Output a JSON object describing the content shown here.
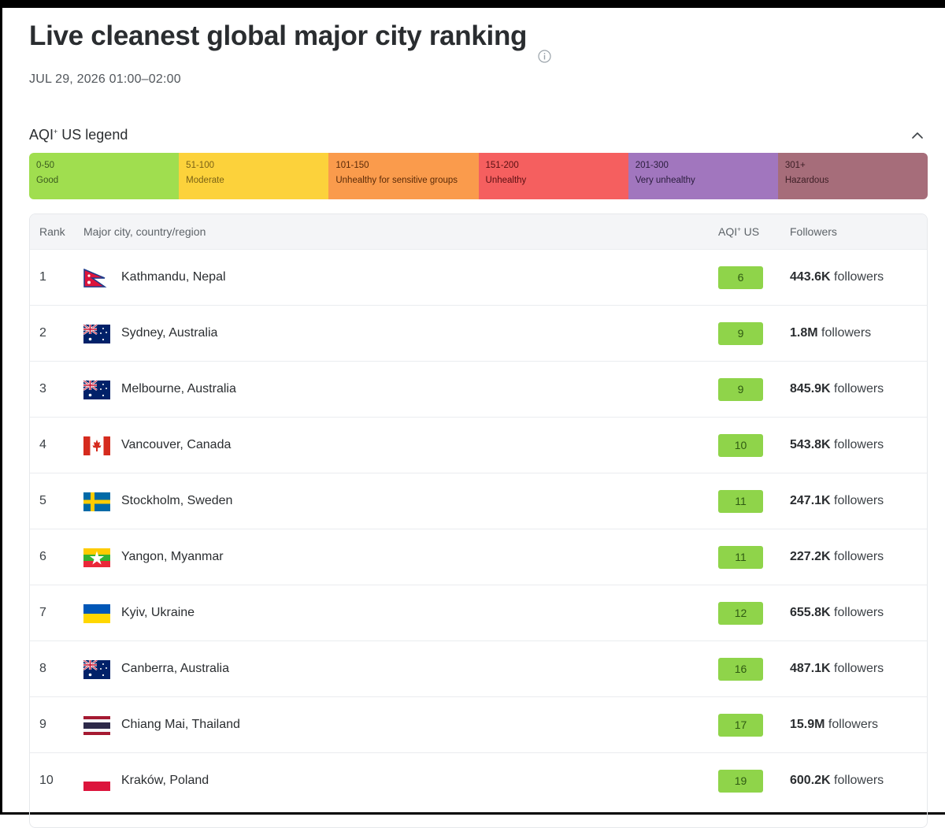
{
  "page": {
    "title": "Live cleanest global major city ranking",
    "datetime": "JUL 29, 2026 01:00–02:00"
  },
  "legend": {
    "title": "AQI",
    "title_sup": "+",
    "title_suffix": " US legend",
    "items": [
      {
        "range": "0-50",
        "label": "Good",
        "color": "#a0de4f"
      },
      {
        "range": "51-100",
        "label": "Moderate",
        "color": "#fcd23b"
      },
      {
        "range": "101-150",
        "label": "Unhealthy for sensitive groups",
        "color": "#fa9b4c"
      },
      {
        "range": "151-200",
        "label": "Unhealthy",
        "color": "#f55f5f"
      },
      {
        "range": "201-300",
        "label": "Very unhealthy",
        "color": "#a176be"
      },
      {
        "range": "301+",
        "label": "Hazardous",
        "color": "#a66d7a"
      }
    ]
  },
  "table": {
    "headers": {
      "rank": "Rank",
      "city": "Major city, country/region",
      "aqi": "AQI",
      "aqi_sup": "+",
      "aqi_suffix": " US",
      "followers": "Followers"
    },
    "followers_suffix": " followers",
    "rows": [
      {
        "rank": "1",
        "city": "Kathmandu, Nepal",
        "flag": "nepal",
        "aqi": "6",
        "followers": "443.6K"
      },
      {
        "rank": "2",
        "city": "Sydney, Australia",
        "flag": "australia",
        "aqi": "9",
        "followers": "1.8M"
      },
      {
        "rank": "3",
        "city": "Melbourne, Australia",
        "flag": "australia",
        "aqi": "9",
        "followers": "845.9K"
      },
      {
        "rank": "4",
        "city": "Vancouver, Canada",
        "flag": "canada",
        "aqi": "10",
        "followers": "543.8K"
      },
      {
        "rank": "5",
        "city": "Stockholm, Sweden",
        "flag": "sweden",
        "aqi": "11",
        "followers": "247.1K"
      },
      {
        "rank": "6",
        "city": "Yangon, Myanmar",
        "flag": "myanmar",
        "aqi": "11",
        "followers": "227.2K"
      },
      {
        "rank": "7",
        "city": "Kyiv, Ukraine",
        "flag": "ukraine",
        "aqi": "12",
        "followers": "655.8K"
      },
      {
        "rank": "8",
        "city": "Canberra, Australia",
        "flag": "australia",
        "aqi": "16",
        "followers": "487.1K"
      },
      {
        "rank": "9",
        "city": "Chiang Mai, Thailand",
        "flag": "thailand",
        "aqi": "17",
        "followers": "15.9M"
      },
      {
        "rank": "10",
        "city": "Kraków, Poland",
        "flag": "poland",
        "aqi": "19",
        "followers": "600.2K"
      }
    ]
  },
  "colors": {
    "aqi_good": "#8fd44a"
  }
}
